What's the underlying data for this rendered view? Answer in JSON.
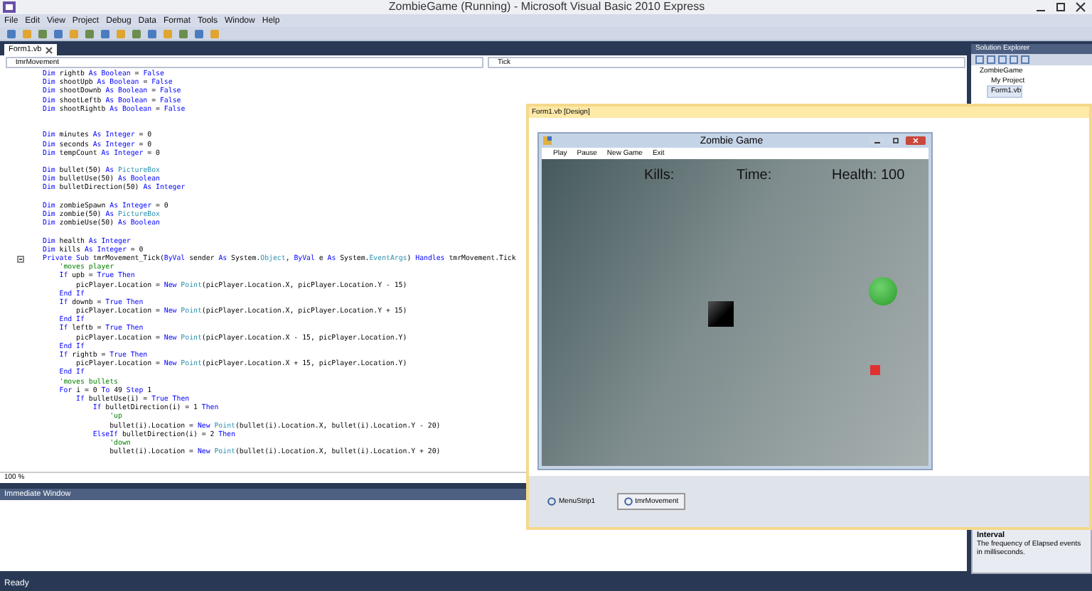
{
  "window": {
    "title": "ZombieGame (Running) - Microsoft Visual Basic 2010 Express"
  },
  "menu": [
    "File",
    "Edit",
    "View",
    "Project",
    "Debug",
    "Data",
    "Format",
    "Tools",
    "Window",
    "Help"
  ],
  "document_tab": {
    "label": "Form1.vb",
    "selected": true
  },
  "code_editor": {
    "object_dropdown": "tmrMovement",
    "event_dropdown": "Tick",
    "zoom": "100 %",
    "lines": [
      {
        "kind": "code",
        "segs": [
          {
            "kind": "keyword",
            "text": "Dim"
          },
          {
            "kind": "plain",
            "text": " rightb "
          },
          {
            "kind": "keyword",
            "text": "As Boolean"
          },
          {
            "kind": "plain",
            "text": " = "
          },
          {
            "kind": "keyword",
            "text": "False"
          }
        ]
      },
      {
        "kind": "code",
        "segs": [
          {
            "kind": "keyword",
            "text": "Dim"
          },
          {
            "kind": "plain",
            "text": " shootUpb "
          },
          {
            "kind": "keyword",
            "text": "As Boolean"
          },
          {
            "kind": "plain",
            "text": " = "
          },
          {
            "kind": "keyword",
            "text": "False"
          }
        ]
      },
      {
        "kind": "code",
        "segs": [
          {
            "kind": "keyword",
            "text": "Dim"
          },
          {
            "kind": "plain",
            "text": " shootDownb "
          },
          {
            "kind": "keyword",
            "text": "As Boolean"
          },
          {
            "kind": "plain",
            "text": " = "
          },
          {
            "kind": "keyword",
            "text": "False"
          }
        ]
      },
      {
        "kind": "code",
        "segs": [
          {
            "kind": "keyword",
            "text": "Dim"
          },
          {
            "kind": "plain",
            "text": " shootLeftb "
          },
          {
            "kind": "keyword",
            "text": "As Boolean"
          },
          {
            "kind": "plain",
            "text": " = "
          },
          {
            "kind": "keyword",
            "text": "False"
          }
        ]
      },
      {
        "kind": "code",
        "segs": [
          {
            "kind": "keyword",
            "text": "Dim"
          },
          {
            "kind": "plain",
            "text": " shootRightb "
          },
          {
            "kind": "keyword",
            "text": "As Boolean"
          },
          {
            "kind": "plain",
            "text": " = "
          },
          {
            "kind": "keyword",
            "text": "False"
          }
        ]
      },
      {
        "kind": "blank"
      },
      {
        "kind": "blank"
      },
      {
        "kind": "code",
        "segs": [
          {
            "kind": "keyword",
            "text": "Dim"
          },
          {
            "kind": "plain",
            "text": " minutes "
          },
          {
            "kind": "keyword",
            "text": "As Integer"
          },
          {
            "kind": "plain",
            "text": " = 0"
          }
        ]
      },
      {
        "kind": "code",
        "segs": [
          {
            "kind": "keyword",
            "text": "Dim"
          },
          {
            "kind": "plain",
            "text": " seconds "
          },
          {
            "kind": "keyword",
            "text": "As Integer"
          },
          {
            "kind": "plain",
            "text": " = 0"
          }
        ]
      },
      {
        "kind": "code",
        "segs": [
          {
            "kind": "keyword",
            "text": "Dim"
          },
          {
            "kind": "plain",
            "text": " tempCount "
          },
          {
            "kind": "keyword",
            "text": "As Integer"
          },
          {
            "kind": "plain",
            "text": " = 0"
          }
        ]
      },
      {
        "kind": "blank"
      },
      {
        "kind": "code",
        "segs": [
          {
            "kind": "keyword",
            "text": "Dim"
          },
          {
            "kind": "plain",
            "text": " bullet(50) "
          },
          {
            "kind": "keyword",
            "text": "As"
          },
          {
            "kind": "type",
            "text": " PictureBox"
          }
        ]
      },
      {
        "kind": "code",
        "segs": [
          {
            "kind": "keyword",
            "text": "Dim"
          },
          {
            "kind": "plain",
            "text": " bulletUse(50) "
          },
          {
            "kind": "keyword",
            "text": "As Boolean"
          }
        ]
      },
      {
        "kind": "code",
        "segs": [
          {
            "kind": "keyword",
            "text": "Dim"
          },
          {
            "kind": "plain",
            "text": " bulletDirection(50) "
          },
          {
            "kind": "keyword",
            "text": "As Integer"
          }
        ]
      },
      {
        "kind": "blank"
      },
      {
        "kind": "code",
        "segs": [
          {
            "kind": "keyword",
            "text": "Dim"
          },
          {
            "kind": "plain",
            "text": " zombieSpawn "
          },
          {
            "kind": "keyword",
            "text": "As Integer"
          },
          {
            "kind": "plain",
            "text": " = 0"
          }
        ]
      },
      {
        "kind": "code",
        "segs": [
          {
            "kind": "keyword",
            "text": "Dim"
          },
          {
            "kind": "plain",
            "text": " zombie(50) "
          },
          {
            "kind": "keyword",
            "text": "As"
          },
          {
            "kind": "type",
            "text": " PictureBox"
          }
        ]
      },
      {
        "kind": "code",
        "segs": [
          {
            "kind": "keyword",
            "text": "Dim"
          },
          {
            "kind": "plain",
            "text": " zombieUse(50) "
          },
          {
            "kind": "keyword",
            "text": "As Boolean"
          }
        ]
      },
      {
        "kind": "blank"
      },
      {
        "kind": "code",
        "segs": [
          {
            "kind": "keyword",
            "text": "Dim"
          },
          {
            "kind": "plain",
            "text": " health "
          },
          {
            "kind": "keyword",
            "text": "As Integer"
          }
        ]
      },
      {
        "kind": "code",
        "segs": [
          {
            "kind": "keyword",
            "text": "Dim"
          },
          {
            "kind": "plain",
            "text": " kills "
          },
          {
            "kind": "keyword",
            "text": "As Integer"
          },
          {
            "kind": "plain",
            "text": " = 0"
          }
        ]
      },
      {
        "kind": "code",
        "fold": true,
        "segs": [
          {
            "kind": "keyword",
            "text": "Private Sub"
          },
          {
            "kind": "plain",
            "text": " tmrMovement_Tick("
          },
          {
            "kind": "keyword",
            "text": "ByVal"
          },
          {
            "kind": "plain",
            "text": " sender "
          },
          {
            "kind": "keyword",
            "text": "As"
          },
          {
            "kind": "plain",
            "text": " System."
          },
          {
            "kind": "type",
            "text": "Object"
          },
          {
            "kind": "plain",
            "text": ", "
          },
          {
            "kind": "keyword",
            "text": "ByVal"
          },
          {
            "kind": "plain",
            "text": " e "
          },
          {
            "kind": "keyword",
            "text": "As"
          },
          {
            "kind": "plain",
            "text": " System."
          },
          {
            "kind": "type",
            "text": "EventArgs"
          },
          {
            "kind": "plain",
            "text": ") "
          },
          {
            "kind": "keyword",
            "text": "Handles"
          },
          {
            "kind": "plain",
            "text": " tmrMovement.Tick"
          }
        ]
      },
      {
        "kind": "code",
        "segs": [
          {
            "kind": "comment",
            "text": "    'moves player"
          }
        ]
      },
      {
        "kind": "code",
        "segs": [
          {
            "kind": "keyword",
            "text": "    If"
          },
          {
            "kind": "plain",
            "text": " upb = "
          },
          {
            "kind": "keyword",
            "text": "True Then"
          }
        ]
      },
      {
        "kind": "code",
        "segs": [
          {
            "kind": "plain",
            "text": "        picPlayer.Location = "
          },
          {
            "kind": "keyword",
            "text": "New"
          },
          {
            "kind": "type",
            "text": " Point"
          },
          {
            "kind": "plain",
            "text": "(picPlayer.Location.X, picPlayer.Location.Y - 15)"
          }
        ]
      },
      {
        "kind": "code",
        "segs": [
          {
            "kind": "keyword",
            "text": "    End If"
          }
        ]
      },
      {
        "kind": "code",
        "segs": [
          {
            "kind": "keyword",
            "text": "    If"
          },
          {
            "kind": "plain",
            "text": " downb = "
          },
          {
            "kind": "keyword",
            "text": "True Then"
          }
        ]
      },
      {
        "kind": "code",
        "segs": [
          {
            "kind": "plain",
            "text": "        picPlayer.Location = "
          },
          {
            "kind": "keyword",
            "text": "New"
          },
          {
            "kind": "type",
            "text": " Point"
          },
          {
            "kind": "plain",
            "text": "(picPlayer.Location.X, picPlayer.Location.Y + 15)"
          }
        ]
      },
      {
        "kind": "code",
        "segs": [
          {
            "kind": "keyword",
            "text": "    End If"
          }
        ]
      },
      {
        "kind": "code",
        "segs": [
          {
            "kind": "keyword",
            "text": "    If"
          },
          {
            "kind": "plain",
            "text": " leftb = "
          },
          {
            "kind": "keyword",
            "text": "True Then"
          }
        ]
      },
      {
        "kind": "code",
        "segs": [
          {
            "kind": "plain",
            "text": "        picPlayer.Location = "
          },
          {
            "kind": "keyword",
            "text": "New"
          },
          {
            "kind": "type",
            "text": " Point"
          },
          {
            "kind": "plain",
            "text": "(picPlayer.Location.X - 15, picPlayer.Location.Y)"
          }
        ]
      },
      {
        "kind": "code",
        "segs": [
          {
            "kind": "keyword",
            "text": "    End If"
          }
        ]
      },
      {
        "kind": "code",
        "segs": [
          {
            "kind": "keyword",
            "text": "    If"
          },
          {
            "kind": "plain",
            "text": " rightb = "
          },
          {
            "kind": "keyword",
            "text": "True Then"
          }
        ]
      },
      {
        "kind": "code",
        "segs": [
          {
            "kind": "plain",
            "text": "        picPlayer.Location = "
          },
          {
            "kind": "keyword",
            "text": "New"
          },
          {
            "kind": "type",
            "text": " Point"
          },
          {
            "kind": "plain",
            "text": "(picPlayer.Location.X + 15, picPlayer.Location.Y)"
          }
        ]
      },
      {
        "kind": "code",
        "segs": [
          {
            "kind": "keyword",
            "text": "    End If"
          }
        ]
      },
      {
        "kind": "code",
        "segs": [
          {
            "kind": "comment",
            "text": "    'moves bullets"
          }
        ]
      },
      {
        "kind": "code",
        "segs": [
          {
            "kind": "keyword",
            "text": "    For"
          },
          {
            "kind": "plain",
            "text": " i = 0 "
          },
          {
            "kind": "keyword",
            "text": "To"
          },
          {
            "kind": "plain",
            "text": " 49 "
          },
          {
            "kind": "keyword",
            "text": "Step"
          },
          {
            "kind": "plain",
            "text": " 1"
          }
        ]
      },
      {
        "kind": "code",
        "segs": [
          {
            "kind": "keyword",
            "text": "        If"
          },
          {
            "kind": "plain",
            "text": " bulletUse(i) = "
          },
          {
            "kind": "keyword",
            "text": "True Then"
          }
        ]
      },
      {
        "kind": "code",
        "segs": [
          {
            "kind": "keyword",
            "text": "            If"
          },
          {
            "kind": "plain",
            "text": " bulletDirection(i) = 1 "
          },
          {
            "kind": "keyword",
            "text": "Then"
          }
        ]
      },
      {
        "kind": "code",
        "segs": [
          {
            "kind": "comment",
            "text": "                'up"
          }
        ]
      },
      {
        "kind": "code",
        "segs": [
          {
            "kind": "plain",
            "text": "                bullet(i).Location = "
          },
          {
            "kind": "keyword",
            "text": "New"
          },
          {
            "kind": "type",
            "text": " Point"
          },
          {
            "kind": "plain",
            "text": "(bullet(i).Location.X, bullet(i).Location.Y - 20)"
          }
        ]
      },
      {
        "kind": "code",
        "segs": [
          {
            "kind": "keyword",
            "text": "            ElseIf"
          },
          {
            "kind": "plain",
            "text": " bulletDirection(i) = 2 "
          },
          {
            "kind": "keyword",
            "text": "Then"
          }
        ]
      },
      {
        "kind": "code",
        "segs": [
          {
            "kind": "comment",
            "text": "                'down"
          }
        ]
      },
      {
        "kind": "code",
        "segs": [
          {
            "kind": "plain",
            "text": "                bullet(i).Location = "
          },
          {
            "kind": "keyword",
            "text": "New"
          },
          {
            "kind": "type",
            "text": " Point"
          },
          {
            "kind": "plain",
            "text": "(bullet(i).Location.X, bullet(i).Location.Y + 20)"
          }
        ]
      }
    ]
  },
  "designer": {
    "title": "Form1.vb [Design]",
    "form": {
      "title": "Zombie Game",
      "menu": [
        "Play",
        "Pause",
        "New Game",
        "Exit"
      ],
      "labels": [
        "Kills:",
        "Time:",
        "Health: 100"
      ]
    },
    "tray": [
      {
        "label": "MenuStrip1",
        "selected": false
      },
      {
        "label": "tmrMovement",
        "selected": true
      }
    ]
  },
  "solution_explorer": {
    "title": "Solution Explorer",
    "tree": [
      {
        "label": "ZombieGame",
        "selected": false,
        "children": [
          {
            "label": "My Project",
            "selected": false
          },
          {
            "label": "Form1.vb",
            "selected": true
          }
        ]
      }
    ]
  },
  "immediate_window": {
    "title": "Immediate Window"
  },
  "properties": {
    "name": "Interval",
    "description": "The frequency of Elapsed events in milliseconds."
  },
  "status_bar": {
    "text": "Ready"
  }
}
